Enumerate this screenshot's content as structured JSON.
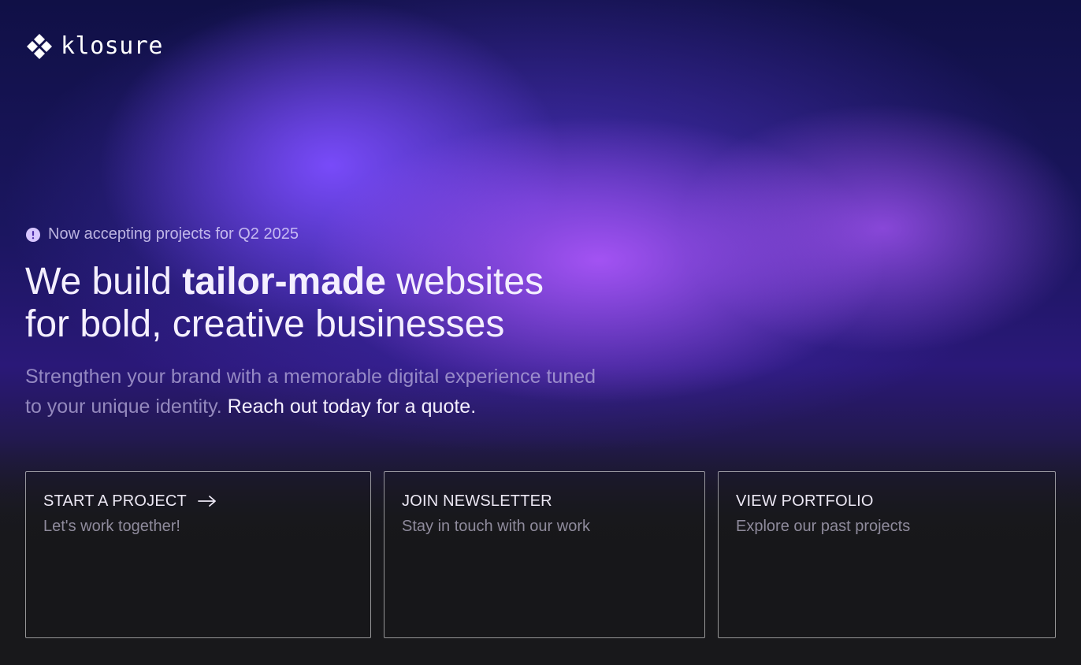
{
  "brand": {
    "name": "klosure",
    "logo_icon": "klosure-mark-icon"
  },
  "hero": {
    "announcement": "Now accepting projects for Q2 2025",
    "announcement_icon": "alert-circle-icon",
    "headline_line1_pre": "We build ",
    "headline_line1_bold": "tailor-made",
    "headline_line1_post": " websites",
    "headline_line2": "for bold, creative businesses",
    "subtext_dim": "Strengthen your brand with a memorable digital experience tuned to your unique identity.",
    "subtext_emphasis": "Reach out today for a quote."
  },
  "cards": [
    {
      "title": "START A PROJECT",
      "subtitle": "Let's work together!",
      "icon": "arrow-right-icon"
    },
    {
      "title": "JOIN NEWSLETTER",
      "subtitle": "Stay in touch with our work"
    },
    {
      "title": "VIEW PORTFOLIO",
      "subtitle": "Explore our past projects"
    }
  ],
  "colors": {
    "accent_violet": "#7c4dff",
    "accent_purple": "#a855f7",
    "background_dark": "#18181b",
    "text_light": "#f4efff"
  }
}
